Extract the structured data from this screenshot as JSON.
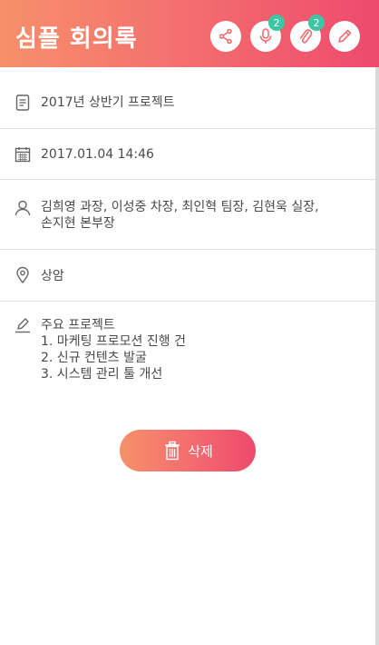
{
  "header": {
    "title": "심플 회의록",
    "buttons": {
      "share": {
        "icon": "share-icon"
      },
      "voice": {
        "icon": "microphone-icon",
        "badge": "2"
      },
      "attach": {
        "icon": "paperclip-icon",
        "badge": "2"
      },
      "edit": {
        "icon": "pencil-icon"
      }
    }
  },
  "meeting": {
    "title": "2017년 상반기 프로젝트",
    "datetime": "2017.01.04 14:46",
    "attendees_line1": "김희영 과장, 이성중 차장, 최인혁 팀장, 김현욱 실장,",
    "attendees_line2": "손지현 본부장",
    "location": "상암",
    "notes": [
      "주요 프로젝트",
      "1. 마케팅 프로모션 진행 건",
      "2. 신규 컨텐츠 발굴",
      "3. 시스템 관리 툴 개선"
    ]
  },
  "actions": {
    "delete_label": "삭제",
    "delete_icon": "trash-icon"
  },
  "colors": {
    "accent_start": "#f7906a",
    "accent_end": "#ee4a6d",
    "badge": "#3cc7a4"
  }
}
